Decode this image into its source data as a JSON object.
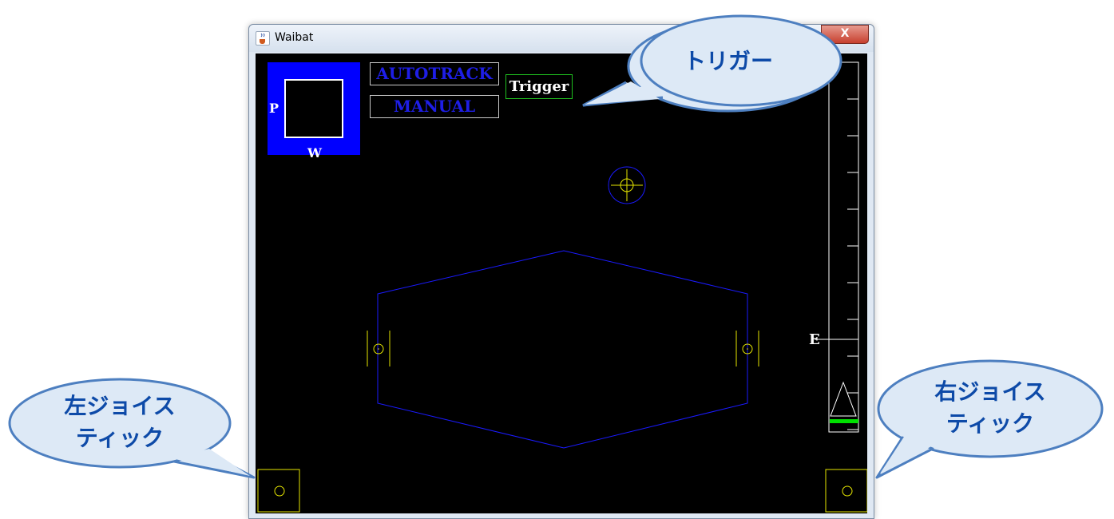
{
  "window": {
    "title": "Waibat",
    "close_glyph": "X",
    "icon": "java-cup-icon"
  },
  "mode_buttons": {
    "autotrack_label": "AUTOTRACK",
    "manual_label": "MANUAL"
  },
  "trigger": {
    "label": "Trigger"
  },
  "pw_indicator": {
    "p_label": "P",
    "w_label": "W"
  },
  "gauge": {
    "e_label": "E"
  },
  "callouts": {
    "trigger": "トリガー",
    "left_joystick_line1": "左ジョイス",
    "left_joystick_line2": "ティック",
    "right_joystick_line1": "右ジョイス",
    "right_joystick_line2": "ティック"
  },
  "colors": {
    "canvas_bg": "#000000",
    "pw_box": "#0000ff",
    "mode_text": "#1e1ee6",
    "trigger_border": "#1fbf1f",
    "hexagon": "#1a1aff",
    "yellow": "#e6e600",
    "green_bar": "#00e000",
    "callout_fill": "#dde9f6",
    "callout_stroke": "#4d7fc0",
    "callout_text": "#0d4aa8"
  }
}
